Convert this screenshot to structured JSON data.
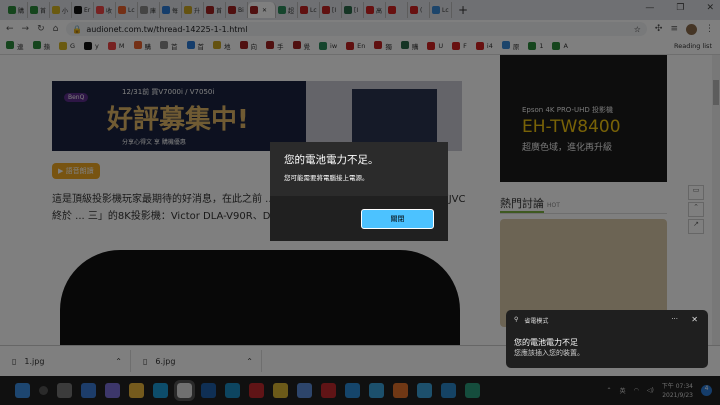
{
  "browser": {
    "tabs": [
      "購",
      "首",
      "小",
      "Er",
      "收",
      "Lc",
      "庫",
      "每",
      "升",
      "首",
      "Bi",
      "",
      "超",
      "Lc",
      "[I",
      "[I",
      "高",
      "",
      "(",
      "Lc"
    ],
    "url": "audionet.com.tw/thread-14225-1-1.html",
    "bookmarks": [
      "連",
      "蘋",
      "G",
      "y",
      "M",
      "購",
      "首",
      "首",
      "地",
      "向",
      "手",
      "覺",
      "iw",
      "En",
      "獨",
      "購",
      "U",
      "F",
      "i4",
      "原",
      "1",
      "A"
    ],
    "reading_list": "Reading list"
  },
  "page": {
    "banner": {
      "logo": "BenQ",
      "line1": "12/31前 買V7000i / V7050i",
      "headline": "好評募集中!",
      "line3": "分享心得文 享 購機優惠"
    },
    "voice_button": "▶ 語音朗讀",
    "article": "這是頂級投影機玩家最期待的好消息，在此之前 ... 4K，但是這幾年卻在8K「卡關」，現在JVC終於 ... 三」的8K投影機：Victor DLA-V90R、DLA-V80R",
    "side_ad": {
      "line1": "Epson 4K PRO-UHD 投影機",
      "model": "EH-TW8400",
      "line3": "超廣色域，進化再升級"
    },
    "hot": {
      "title": "熱門討論",
      "tag": "HOT"
    }
  },
  "downloads": [
    {
      "name": "1.jpg"
    },
    {
      "name": "6.jpg"
    }
  ],
  "dialog": {
    "title": "您的電池電力不足。",
    "message": "您可能需要將電腦接上電源。",
    "close_button": "關閉"
  },
  "toast": {
    "app": "省電模式",
    "more": "···",
    "line1": "您的電池電力不足",
    "line2": "您應該插入您的裝置。"
  },
  "tray": {
    "ime": "英",
    "time": "下午 07:34",
    "date": "2021/9/23",
    "badge": "4"
  },
  "taskbar_colors": [
    "#3a8de0",
    "#555",
    "#777",
    "#3a7bd5",
    "#7b6fd6",
    "#e8b43a",
    "#1a9ad6",
    "#e0e0e0",
    "#1f5fa8",
    "#1a8ac0",
    "#c0282d",
    "#d9b533",
    "#5b8bd6",
    "#c0282d",
    "#2a8ad6",
    "#39a0d8",
    "#e0702a",
    "#3aa0d8",
    "#2a86c8",
    "#2a9a7a"
  ]
}
